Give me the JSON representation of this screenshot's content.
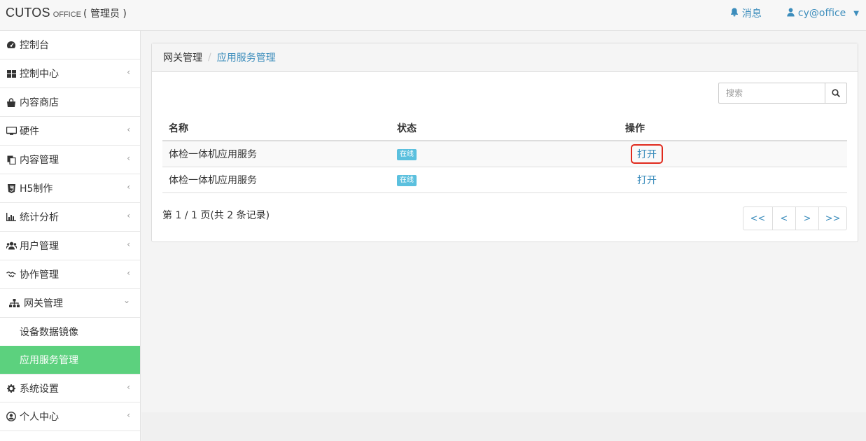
{
  "brand": {
    "name": "CUTOS",
    "sub": "OFFICE",
    "role": "( 管理员 )"
  },
  "topbar": {
    "messages_label": "消息",
    "user_label": "cy@office"
  },
  "sidebar": {
    "items": [
      {
        "label": "控制台",
        "icon": "dashboard-icon"
      },
      {
        "label": "控制中心",
        "icon": "grid-icon"
      },
      {
        "label": "内容商店",
        "icon": "shopping-bag-icon"
      },
      {
        "label": "硬件",
        "icon": "desktop-icon"
      },
      {
        "label": "内容管理",
        "icon": "copy-icon"
      },
      {
        "label": "H5制作",
        "icon": "html5-icon"
      },
      {
        "label": "统计分析",
        "icon": "bar-chart-icon"
      },
      {
        "label": "用户管理",
        "icon": "users-icon"
      },
      {
        "label": "协作管理",
        "icon": "handshake-icon"
      },
      {
        "label": "网关管理",
        "icon": "sitemap-icon"
      },
      {
        "label": "系统设置",
        "icon": "gear-icon"
      },
      {
        "label": "个人中心",
        "icon": "user-circle-icon"
      }
    ],
    "gateway_sub": [
      {
        "label": "设备数据镜像"
      },
      {
        "label": "应用服务管理"
      }
    ]
  },
  "breadcrumb": {
    "parent": "网关管理",
    "separator": "/",
    "current": "应用服务管理"
  },
  "search": {
    "placeholder": "搜索"
  },
  "table": {
    "headers": {
      "name": "名称",
      "status": "状态",
      "action": "操作"
    },
    "rows": [
      {
        "name": "体检一体机应用服务",
        "status": "在线",
        "action": "打开"
      },
      {
        "name": "体检一体机应用服务",
        "status": "在线",
        "action": "打开"
      }
    ]
  },
  "pagination": {
    "info": "第 1 / 1 页(共 2 条记录)",
    "first": "<<",
    "prev": "<",
    "next": ">",
    "last": ">>"
  },
  "colors": {
    "accent": "#3c8dbc",
    "active_menu": "#5cd17e",
    "badge": "#5bc0de",
    "highlight": "#e02a1d"
  }
}
